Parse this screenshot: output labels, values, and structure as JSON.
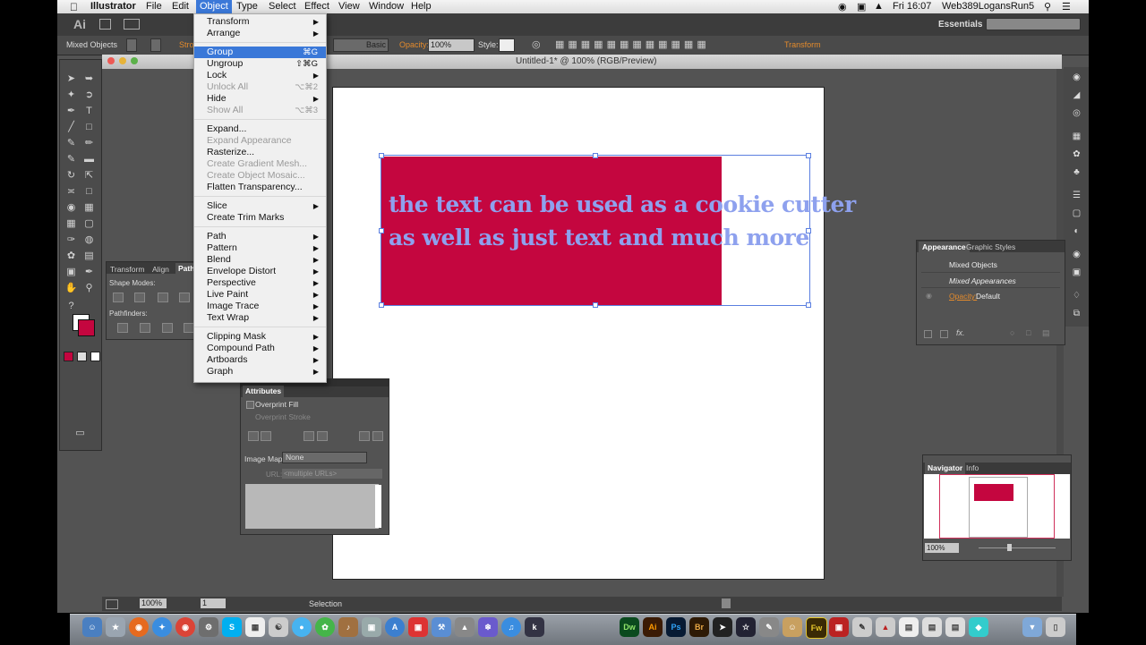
{
  "menubar": {
    "app_name": "Illustrator",
    "items": [
      "File",
      "Edit",
      "Object",
      "Type",
      "Select",
      "Effect",
      "View",
      "Window",
      "Help"
    ],
    "clock": "Fri 16:07",
    "user": "Web389LogansRun5"
  },
  "appbar": {
    "logo": "Ai",
    "workspace": "Essentials"
  },
  "control_bar": {
    "selection_label": "Mixed Objects",
    "stroke_label": "Stro",
    "brush_label": "Basic",
    "opacity_label": "Opacity:",
    "opacity_value": "100%",
    "style_label": "Style:",
    "transform_label": "Transform"
  },
  "document": {
    "title": "Untitled-1* @ 100% (RGB/Preview)"
  },
  "artwork": {
    "text_line1": "the text can be used as a cookie cutter",
    "text_line2": "as well as just text and much more",
    "fill_color": "#c4063f",
    "text_color": "#8ea1ee"
  },
  "object_menu": {
    "items": [
      {
        "label": "Transform",
        "submenu": true
      },
      {
        "label": "Arrange",
        "submenu": true
      },
      {
        "sep": true
      },
      {
        "label": "Group",
        "shortcut": "⌘G",
        "highlighted": true
      },
      {
        "label": "Ungroup",
        "shortcut": "⇧⌘G"
      },
      {
        "label": "Lock",
        "submenu": true
      },
      {
        "label": "Unlock All",
        "shortcut": "⌥⌘2",
        "disabled": true
      },
      {
        "label": "Hide",
        "submenu": true
      },
      {
        "label": "Show All",
        "shortcut": "⌥⌘3",
        "disabled": true
      },
      {
        "sep": true
      },
      {
        "label": "Expand..."
      },
      {
        "label": "Expand Appearance",
        "disabled": true
      },
      {
        "label": "Rasterize..."
      },
      {
        "label": "Create Gradient Mesh...",
        "disabled": true
      },
      {
        "label": "Create Object Mosaic...",
        "disabled": true
      },
      {
        "label": "Flatten Transparency..."
      },
      {
        "sep": true
      },
      {
        "label": "Slice",
        "submenu": true
      },
      {
        "label": "Create Trim Marks"
      },
      {
        "sep": true
      },
      {
        "label": "Path",
        "submenu": true
      },
      {
        "label": "Pattern",
        "submenu": true
      },
      {
        "label": "Blend",
        "submenu": true
      },
      {
        "label": "Envelope Distort",
        "submenu": true
      },
      {
        "label": "Perspective",
        "submenu": true
      },
      {
        "label": "Live Paint",
        "submenu": true
      },
      {
        "label": "Image Trace",
        "submenu": true
      },
      {
        "label": "Text Wrap",
        "submenu": true
      },
      {
        "sep": true
      },
      {
        "label": "Clipping Mask",
        "submenu": true
      },
      {
        "label": "Compound Path",
        "submenu": true
      },
      {
        "label": "Artboards",
        "submenu": true
      },
      {
        "label": "Graph",
        "submenu": true
      }
    ]
  },
  "pathfinder_panel": {
    "tabs": [
      "Transform",
      "Align",
      "Pathf"
    ],
    "shape_modes_label": "Shape Modes:",
    "pathfinders_label": "Pathfinders:"
  },
  "attributes_panel": {
    "title": "Attributes",
    "overprint_fill": "Overprint Fill",
    "overprint_stroke": "Overprint Stroke",
    "image_map_label": "Image Map:",
    "image_map_value": "None",
    "url_label": "URL:",
    "url_value": "<multiple URLs>"
  },
  "appearance_panel": {
    "tabs": [
      "Appearance",
      "Graphic Styles"
    ],
    "object_label": "Mixed Objects",
    "appearance_label": "Mixed Appearances",
    "opacity_label": "Opacity:",
    "opacity_value": "Default",
    "fx_label": "fx."
  },
  "navigator_panel": {
    "tabs": [
      "Navigator",
      "Info"
    ],
    "zoom_value": "100%"
  },
  "status_bar": {
    "zoom_value": "100%",
    "page_value": "1",
    "tool_label": "Selection"
  },
  "dock": {
    "labeled_icons": [
      "Dw",
      "Ai",
      "Ps",
      "Br",
      "Fw"
    ]
  }
}
